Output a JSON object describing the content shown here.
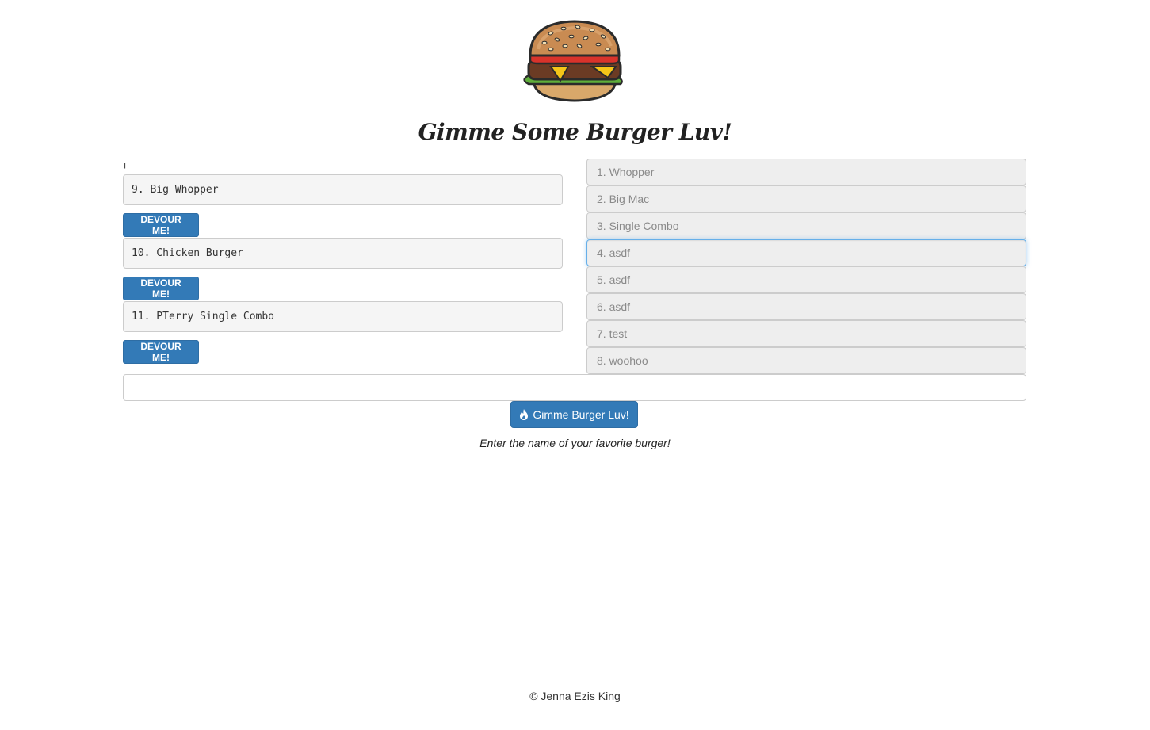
{
  "header": {
    "logo_icon": "hamburger-icon",
    "title": "Gimme Some Burger Luv!"
  },
  "plus_marker": "+",
  "uneaten": [
    {
      "label": "9. Big Whopper",
      "button_label": "DEVOUR ME!"
    },
    {
      "label": "10. Chicken Burger",
      "button_label": "DEVOUR ME!"
    },
    {
      "label": "11. PTerry Single Combo",
      "button_label": "DEVOUR ME!"
    }
  ],
  "eaten": [
    {
      "label": "1. Whopper"
    },
    {
      "label": "2. Big Mac"
    },
    {
      "label": "3. Single Combo"
    },
    {
      "label": "4. asdf",
      "focused": true
    },
    {
      "label": "5. asdf"
    },
    {
      "label": "6. asdf"
    },
    {
      "label": "7. test"
    },
    {
      "label": "8. woohoo"
    }
  ],
  "form": {
    "input_value": "",
    "submit_label": "Gimme Burger Luv!",
    "submit_icon": "flame-icon",
    "hint": "Enter the name of your favorite burger!"
  },
  "footer": {
    "text": "© Jenna Ezis King"
  },
  "colors": {
    "primary": "#337ab7",
    "eaten_bg": "#eeeeee",
    "eaten_text": "#8a8a8a",
    "focus_border": "#66afe9"
  }
}
